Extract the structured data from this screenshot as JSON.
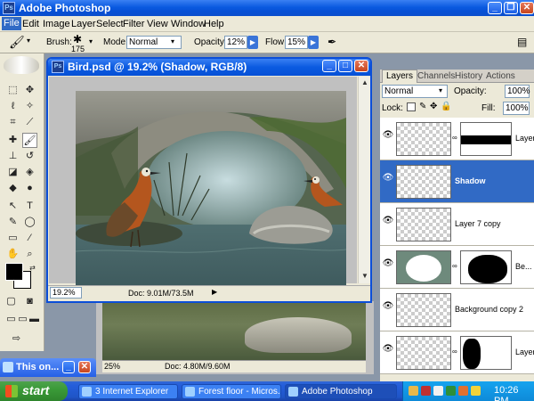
{
  "window": {
    "title": "Adobe Photoshop",
    "app_icon": "photoshop-icon"
  },
  "menu": {
    "items": [
      "File",
      "Edit",
      "Image",
      "Layer",
      "Select",
      "Filter",
      "View",
      "Window",
      "Help"
    ]
  },
  "options": {
    "brush_label": "Brush:",
    "brush_size": "175",
    "mode_label": "Mode:",
    "mode_value": "Normal",
    "opacity_label": "Opacity:",
    "opacity_value": "12%",
    "flow_label": "Flow:",
    "flow_value": "15%"
  },
  "document": {
    "title": "Bird.psd @ 19.2% (Shadow, RGB/8)",
    "zoom": "19.2%",
    "doc_size": "Doc: 9.01M/73.5M"
  },
  "document2": {
    "zoom": "25%",
    "doc_size": "Doc: 4.80M/9.60M"
  },
  "layers_panel": {
    "tabs": [
      "Layers",
      "Channels",
      "History",
      "Actions"
    ],
    "blend_mode": "Normal",
    "opacity_label": "Opacity:",
    "opacity_value": "100%",
    "lock_label": "Lock:",
    "fill_label": "Fill:",
    "fill_value": "100%",
    "layers": [
      {
        "name": "Layer",
        "selected": false
      },
      {
        "name": "Shadow",
        "selected": true
      },
      {
        "name": "Layer 7 copy",
        "selected": false
      },
      {
        "name": "Be...",
        "selected": false
      },
      {
        "name": "Background copy 2",
        "selected": false
      },
      {
        "name": "Layer",
        "selected": false
      }
    ]
  },
  "mini_window": {
    "title": "This on..."
  },
  "taskbar": {
    "start": "start",
    "buttons": [
      "3 Internet Explorer",
      "Forest floor - Micros...",
      "Adobe Photoshop"
    ],
    "clock": "10:26 PM"
  }
}
